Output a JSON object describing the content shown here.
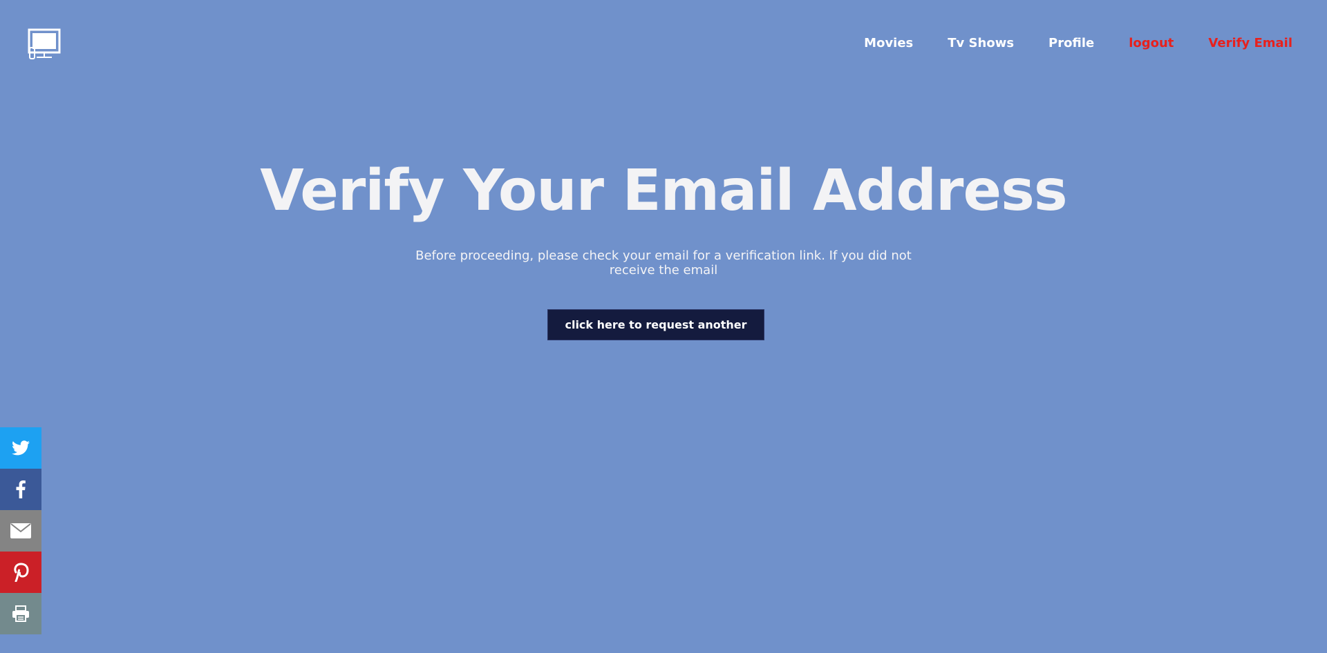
{
  "header": {
    "logo_icon": "tv-monitor-icon",
    "nav": [
      {
        "label": "Movies",
        "color": "#ffffff"
      },
      {
        "label": "Tv Shows",
        "color": "#ffffff"
      },
      {
        "label": "Profile",
        "color": "#ffffff"
      },
      {
        "label": "logout",
        "color": "#e8201c"
      },
      {
        "label": "Verify Email",
        "color": "#e8201c"
      }
    ]
  },
  "main": {
    "title": "Verify Your Email Address",
    "message": "Before proceeding, please check your email for a verification link. If you did not receive the email",
    "request_button": "click here to request another"
  },
  "share_bar": [
    {
      "icon": "twitter-icon",
      "color": "#1da1f2"
    },
    {
      "icon": "facebook-icon",
      "color": "#3b5998"
    },
    {
      "icon": "email-icon",
      "color": "#848484"
    },
    {
      "icon": "pinterest-icon",
      "color": "#cb2027"
    },
    {
      "icon": "print-icon",
      "color": "#738a8d"
    }
  ],
  "colors": {
    "background": "#7091cb",
    "button_bg": "#141b3e",
    "alert": "#e8201c"
  }
}
